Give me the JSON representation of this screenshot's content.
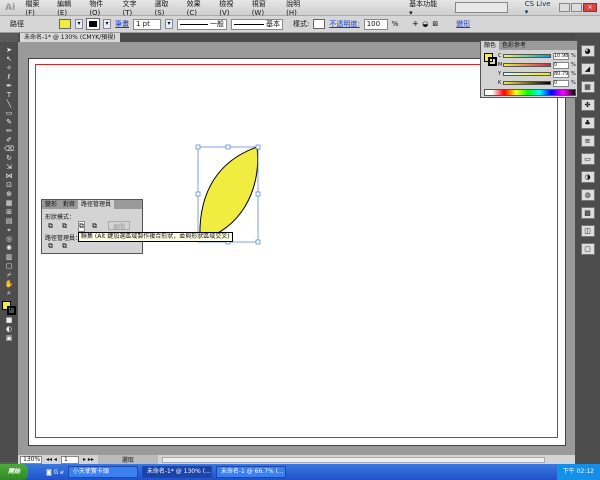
{
  "app": {
    "logo": "Ai",
    "workspace": "基本功能 ▾",
    "cs_live": "CS Live ▾"
  },
  "menu": [
    "檔案(F)",
    "編輯(E)",
    "物件(O)",
    "文字(T)",
    "選取(S)",
    "效果(C)",
    "檢視(V)",
    "視窗(W)",
    "說明(H)"
  ],
  "control": {
    "object_type": "路徑",
    "stroke_label": "筆畫",
    "stroke_weight": "1 pt",
    "profile_label": "一般",
    "brush_label": "基本",
    "style_label": "樣式:",
    "opacity_label": "不透明度:",
    "opacity_value": "100",
    "opacity_unit": "%",
    "transform_link": "變形",
    "fill_color": "#f0ec40",
    "stroke_color": "#000000"
  },
  "document": {
    "tab": "未命名-1* @ 130% (CMYK/預視)"
  },
  "color_panel": {
    "tabs": [
      "顏色",
      "色彩參考"
    ],
    "rows": [
      {
        "label": "C",
        "value": "10.98",
        "unit": "%"
      },
      {
        "label": "M",
        "value": "0",
        "unit": "%"
      },
      {
        "label": "Y",
        "value": "80.79",
        "unit": "%"
      },
      {
        "label": "K",
        "value": "0",
        "unit": "%"
      }
    ]
  },
  "pathfinder_panel": {
    "tabs": [
      "變形",
      "對齊",
      "路徑管理員"
    ],
    "shape_modes_label": "形狀模式：",
    "expand_button": "展開",
    "pathfinders_label": "路徑管理員："
  },
  "tooltip": "聯集 (Alt 鍵加選區域製作複合形狀，並與形狀區域交叉)",
  "status": {
    "zoom": "130%",
    "page": "1",
    "mode": "選取"
  },
  "taskbar": {
    "start": "開始",
    "tasks": [
      "小天使實卡頭",
      "未命名-1* @ 130% (...",
      "未命名-1 @ 66.7% (..."
    ],
    "clock": "下午 02:12"
  }
}
